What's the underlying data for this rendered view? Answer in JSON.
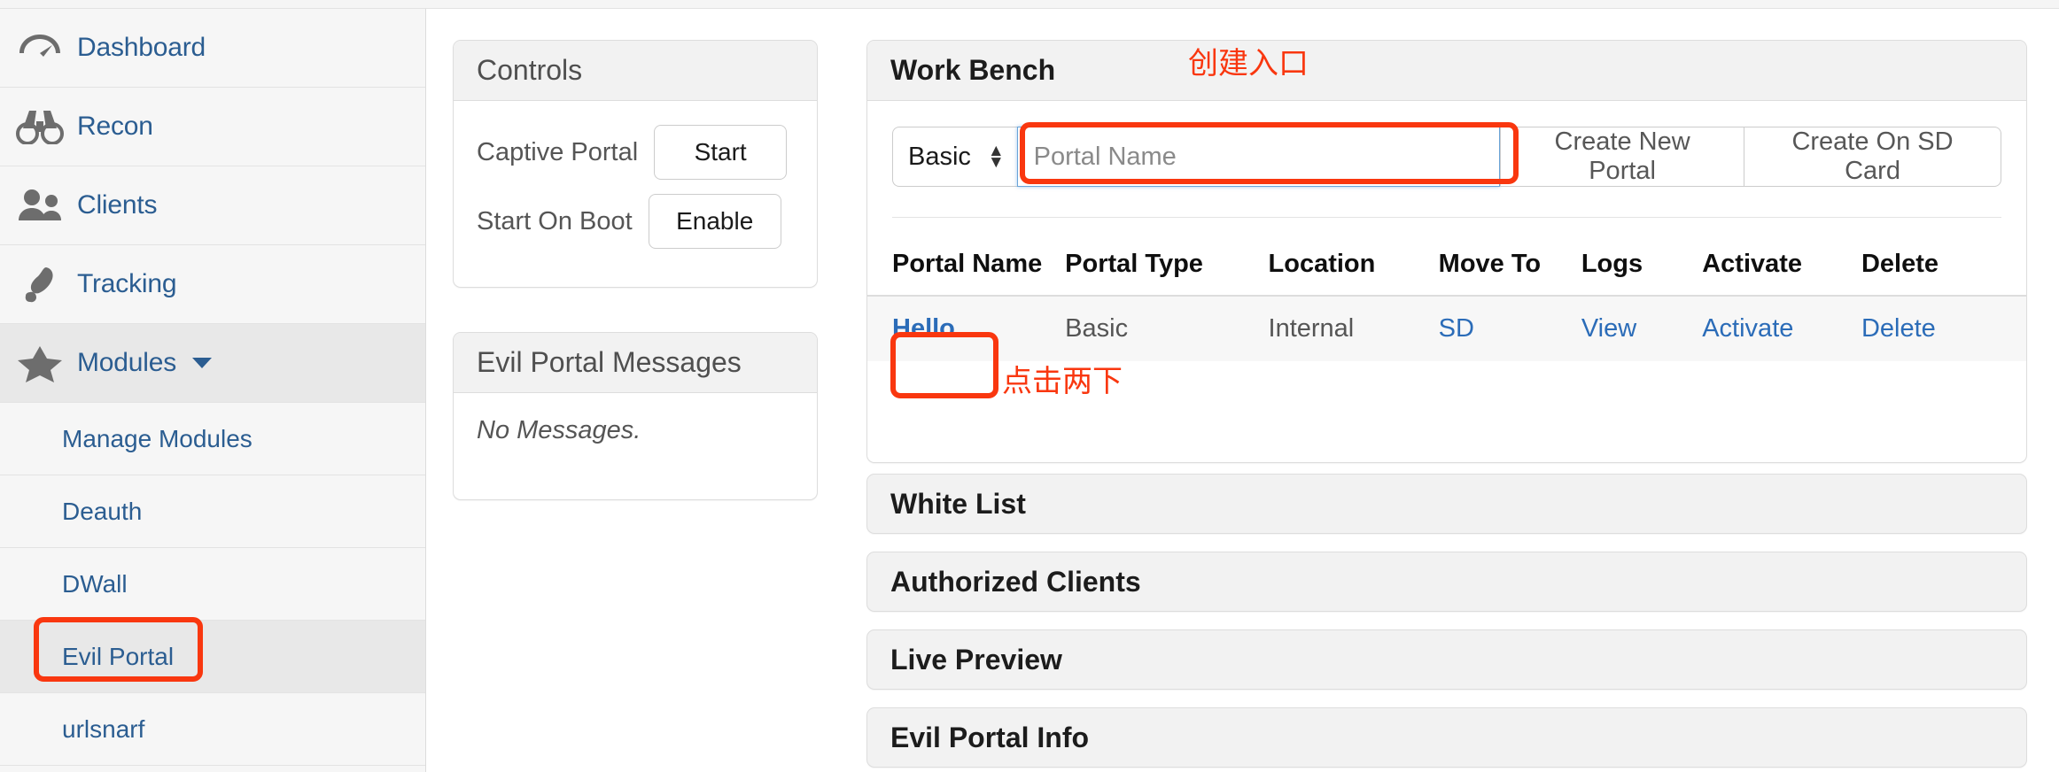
{
  "sidebar": {
    "items": [
      {
        "label": "Dashboard",
        "icon": "gauge-icon",
        "type": "main",
        "active": false
      },
      {
        "label": "Recon",
        "icon": "binoculars-icon",
        "type": "main",
        "active": false
      },
      {
        "label": "Clients",
        "icon": "people-icon",
        "type": "main",
        "active": false
      },
      {
        "label": "Tracking",
        "icon": "footprint-icon",
        "type": "main",
        "active": false
      },
      {
        "label": "Modules",
        "icon": "star-icon",
        "type": "main",
        "active": true,
        "caret": true
      }
    ],
    "sub_items": [
      {
        "label": "Manage Modules",
        "active": false
      },
      {
        "label": "Deauth",
        "active": false
      },
      {
        "label": "DWall",
        "active": false
      },
      {
        "label": "Evil Portal",
        "active": true,
        "highlighted": true
      },
      {
        "label": "urlsnarf",
        "active": false
      }
    ]
  },
  "controls": {
    "title": "Controls",
    "rows": [
      {
        "label": "Captive Portal",
        "button": "Start"
      },
      {
        "label": "Start On Boot",
        "button": "Enable"
      }
    ]
  },
  "messages": {
    "title": "Evil Portal Messages",
    "empty_text": "No Messages."
  },
  "workbench": {
    "title": "Work Bench",
    "portal_type_selected": "Basic",
    "portal_name_value": "",
    "portal_name_placeholder": "Portal Name",
    "create_new_portal_label": "Create New Portal",
    "create_on_sd_card_label": "Create On SD Card",
    "table": {
      "headers": [
        "Portal Name",
        "Portal Type",
        "Location",
        "Move To",
        "Logs",
        "Activate",
        "Delete"
      ],
      "rows": [
        {
          "portal_name": "Hello",
          "portal_type": "Basic",
          "location": "Internal",
          "move_to": "SD",
          "logs": "View",
          "activate": "Activate",
          "delete": "Delete"
        }
      ]
    }
  },
  "accordions": [
    {
      "label": "White List"
    },
    {
      "label": "Authorized Clients"
    },
    {
      "label": "Live Preview"
    },
    {
      "label": "Evil Portal Info"
    }
  ],
  "annotations": {
    "create_entry_text": "创建入口",
    "double_click_text": "点击两下",
    "color": "#f9370f"
  }
}
